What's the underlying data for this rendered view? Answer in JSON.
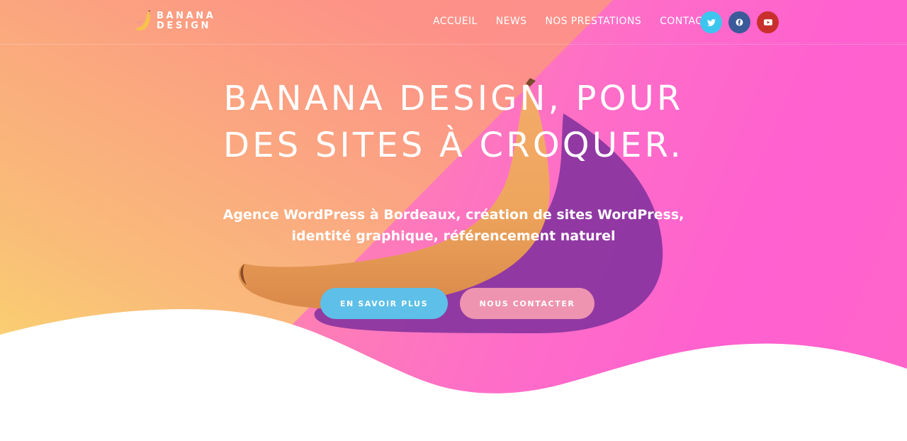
{
  "logo": {
    "line1": "BANANA",
    "line2": "DESIGN",
    "icon": "banana-icon"
  },
  "nav": {
    "items": [
      {
        "label": "ACCUEIL"
      },
      {
        "label": "NEWS"
      },
      {
        "label": "NOS PRESTATIONS"
      },
      {
        "label": "CONTACT"
      }
    ]
  },
  "social": [
    {
      "icon": "twitter-icon",
      "color": "#3cc6ef"
    },
    {
      "icon": "facebook-icon",
      "color": "#3b5a9a"
    },
    {
      "icon": "youtube-icon",
      "color": "#c9302c"
    }
  ],
  "hero": {
    "title_line1": "BANANA DESIGN, POUR",
    "title_line2": "DES SITES À CROQUER.",
    "subtitle": "Agence WordPress à Bordeaux, création de sites WordPress, identité graphique, référencement naturel",
    "cta_primary": "EN SAVOIR PLUS",
    "cta_secondary": "NOUS CONTACTER",
    "cta_primary_color": "#5ec0e8",
    "cta_secondary_color": "#ef94b0"
  }
}
